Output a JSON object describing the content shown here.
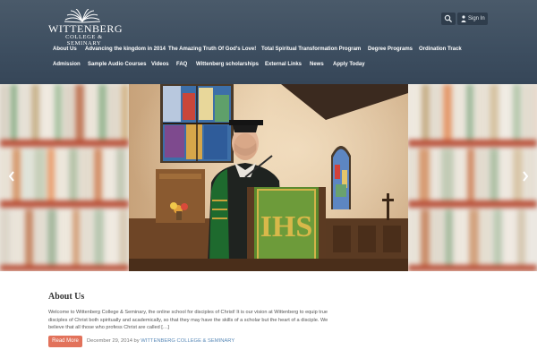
{
  "logo": {
    "line1": "WITTENBERG",
    "line2": "COLLEGE & SEMINARY",
    "icon": "open-book-icon"
  },
  "header_actions": {
    "search_icon": "search-icon",
    "signin_label": "Sign In"
  },
  "nav": {
    "row1": [
      "About Us",
      "Advancing the kingdom in 2014",
      "The Amazing Truth Of God's Love!",
      "Total Spiritual Transformation Program",
      "Degree Programs",
      "Ordination Track"
    ],
    "row2": [
      "Admission",
      "Sample Audio Courses",
      "Videos",
      "FAQ",
      "Wittenberg scholarships",
      "External Links",
      "News",
      "Apply Today"
    ]
  },
  "slider": {
    "prev_icon": "chevron-left-icon",
    "next_icon": "chevron-right-icon",
    "photo_description_icon": "speaker-at-pulpit-photo"
  },
  "post": {
    "title": "About Us",
    "excerpt": "Welcome to Wittenberg College & Seminary, the online school for disciples of Christ! It is our vision at Wittenberg to equip true disciples of Christ both spiritually and academically, so that they may have the skills of a scholar but the heart of a disciple. We believe that all those who profess Christ are called […]",
    "read_more": "Read More",
    "date": "December 29, 2014",
    "by": "by",
    "author": "WITTENBERG COLLEGE & SEMINARY"
  },
  "colors": {
    "header": "#3d4e60",
    "accent": "#e2725b",
    "link": "#5a8ab8"
  }
}
